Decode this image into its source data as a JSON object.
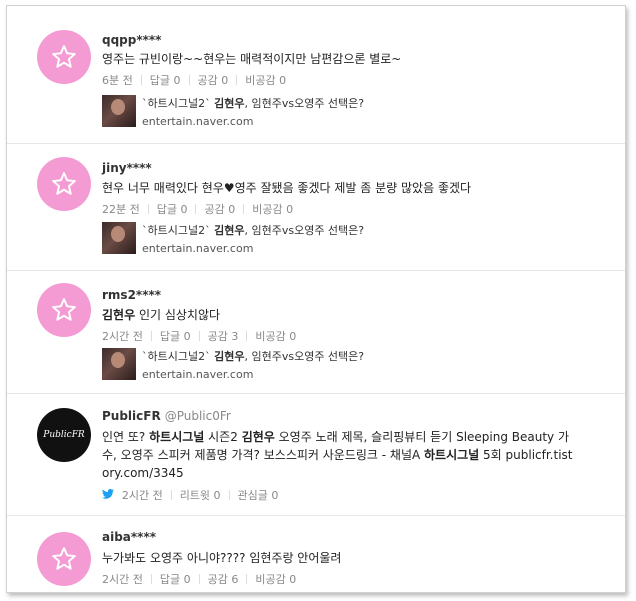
{
  "comments": [
    {
      "username": "qqpp****",
      "text": "영주는 규빈이랑~~현우는 매력적이지만 남편감으론 별로~",
      "time": "6분 전",
      "reply": "답글 0",
      "like": "공감 0",
      "dislike": "비공감 0",
      "link_title_pre": "`하트시그널2` ",
      "link_title_bold": "김현우",
      "link_title_post": ", 임현주vs오영주 선택은?",
      "link_domain": "entertain.naver.com"
    },
    {
      "username": "jiny****",
      "text": "현우 너무 매력있다 현우♥영주 잘됐음 좋겠다 제발 좀 분량 많았음 좋겠다",
      "time": "22분 전",
      "reply": "답글 0",
      "like": "공감 0",
      "dislike": "비공감 0",
      "link_title_pre": "`하트시그널2` ",
      "link_title_bold": "김현우",
      "link_title_post": ", 임현주vs오영주 선택은?",
      "link_domain": "entertain.naver.com"
    },
    {
      "username": "rms2****",
      "text_bold": "김현우",
      "text_rest": " 인기 심상치않다",
      "time": "2시간 전",
      "reply": "답글 0",
      "like": "공감 3",
      "dislike": "비공감 0",
      "link_title_pre": "`하트시그널2` ",
      "link_title_bold": "김현우",
      "link_title_post": ", 임현주vs오영주 선택은?",
      "link_domain": "entertain.naver.com"
    }
  ],
  "tweet": {
    "name": "PublicFR",
    "handle": "@Public0Fr",
    "logo_text": "PublicFR",
    "line1_a": "인연 또? ",
    "line1_b": "하트시그널",
    "line1_c": " 시즌2 ",
    "line1_d": "김현우",
    "line1_e": " 오영주 노래 제목, 슬리핑뷰티 듣기 Sleeping Beauty 가",
    "line2_a": "수, 오영주 스피커 제품명 가격? 보스스피커 사운드링크 - 채널A ",
    "line2_b": "하트시그널",
    "line2_c": " 5회 publicfr.tist",
    "line3": "ory.com/3345",
    "time": "2시간 전",
    "retweet": "리트윗 0",
    "fav": "관심글 0"
  },
  "last_comment": {
    "username": "aiba****",
    "text": "누가봐도 오영주 아니야???? 임현주랑 안어울려",
    "time": "2시간 전",
    "reply": "답글 0",
    "like": "공감 6",
    "dislike": "비공감 0"
  },
  "colors": {
    "avatar": "#f49bd3",
    "twitter": "#1da1f2"
  },
  "icons": {
    "avatar": "star-icon",
    "twitter": "twitter-bird-icon"
  }
}
